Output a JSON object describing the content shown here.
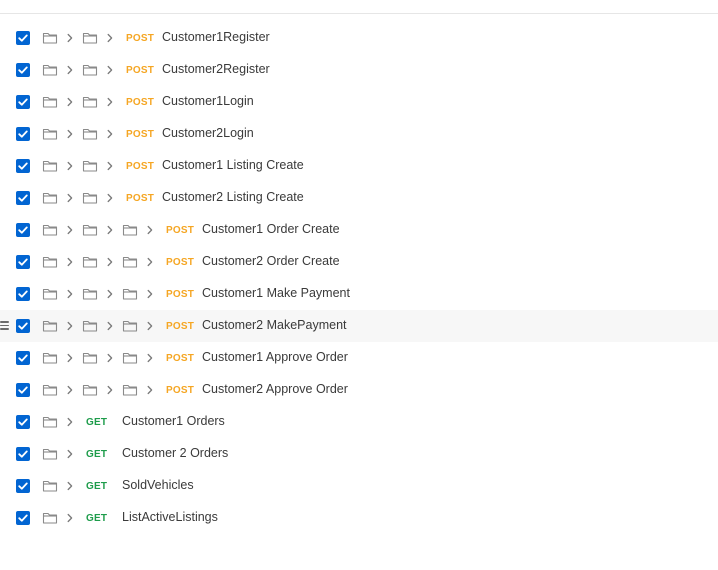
{
  "colors": {
    "checkbox": "#0265d2",
    "post": "#f5a623",
    "get": "#1e9c4b"
  },
  "requests": [
    {
      "depth": 2,
      "method": "POST",
      "name": "Customer1Register",
      "checked": true
    },
    {
      "depth": 2,
      "method": "POST",
      "name": "Customer2Register",
      "checked": true
    },
    {
      "depth": 2,
      "method": "POST",
      "name": "Customer1Login",
      "checked": true
    },
    {
      "depth": 2,
      "method": "POST",
      "name": "Customer2Login",
      "checked": true
    },
    {
      "depth": 2,
      "method": "POST",
      "name": "Customer1 Listing Create",
      "checked": true
    },
    {
      "depth": 2,
      "method": "POST",
      "name": "Customer2 Listing Create",
      "checked": true
    },
    {
      "depth": 3,
      "method": "POST",
      "name": "Customer1 Order Create",
      "checked": true
    },
    {
      "depth": 3,
      "method": "POST",
      "name": "Customer2 Order Create",
      "checked": true
    },
    {
      "depth": 3,
      "method": "POST",
      "name": "Customer1 Make Payment",
      "checked": true
    },
    {
      "depth": 3,
      "method": "POST",
      "name": "Customer2 MakePayment",
      "checked": true,
      "hover": true
    },
    {
      "depth": 3,
      "method": "POST",
      "name": "Customer1 Approve Order",
      "checked": true
    },
    {
      "depth": 3,
      "method": "POST",
      "name": "Customer2 Approve Order",
      "checked": true
    },
    {
      "depth": 1,
      "method": "GET",
      "name": "Customer1 Orders",
      "checked": true
    },
    {
      "depth": 1,
      "method": "GET",
      "name": "Customer 2 Orders",
      "checked": true
    },
    {
      "depth": 1,
      "method": "GET",
      "name": "SoldVehicles",
      "checked": true
    },
    {
      "depth": 1,
      "method": "GET",
      "name": "ListActiveListings",
      "checked": true
    }
  ]
}
